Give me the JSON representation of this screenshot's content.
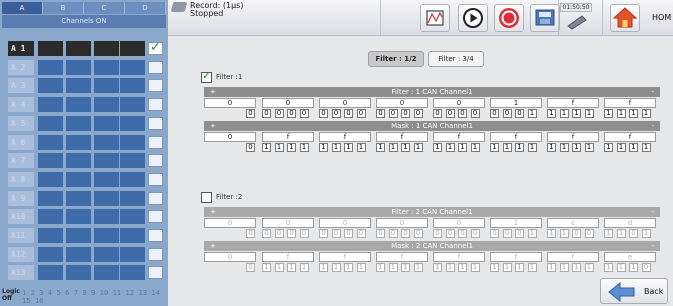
{
  "sidebar": {
    "group_tabs": [
      "A",
      "B",
      "C",
      "D"
    ],
    "channels_label": "Channels ON",
    "channels": [
      {
        "label": "A 1",
        "checked": true
      },
      {
        "label": "A 2",
        "checked": false
      },
      {
        "label": "A 3",
        "checked": false
      },
      {
        "label": "A 4",
        "checked": false
      },
      {
        "label": "A 5",
        "checked": false
      },
      {
        "label": "A 6",
        "checked": false
      },
      {
        "label": "A 7",
        "checked": false
      },
      {
        "label": "A 8",
        "checked": false
      },
      {
        "label": "A 9",
        "checked": false
      },
      {
        "label": "A10",
        "checked": false
      },
      {
        "label": "A11",
        "checked": false
      },
      {
        "label": "A12",
        "checked": false
      },
      {
        "label": "A13",
        "checked": false
      }
    ],
    "logic_label_top": "Logic",
    "logic_label_bottom": "Off",
    "logic_numbers": "1 2 3 4 5 6 7 8 9 10 11 12 13 14 15 16"
  },
  "toolbar": {
    "record_label": "Record: (1µs)",
    "status": "Stopped",
    "time": "01:50:50",
    "home_label": "HOM",
    "icons": [
      "waveform-icon",
      "play-icon",
      "record-icon",
      "save-icon",
      "probe-icon",
      "home-icon"
    ]
  },
  "main": {
    "tabs": [
      {
        "label": "Filter : 1/2",
        "active": true
      },
      {
        "label": "Filter : 3/4",
        "active": false
      }
    ],
    "filters": [
      {
        "label": "Filter :1",
        "checked": true,
        "filter_title": "Filter : 1 CAN Channel1",
        "filter_hex": [
          "0",
          "0",
          "0",
          "0",
          "0",
          "1",
          "f",
          "f"
        ],
        "filter_bits_first": "0",
        "filter_bits": [
          "0000",
          "0000",
          "0000",
          "0000",
          "0001",
          "1111",
          "1111"
        ],
        "mask_title": "Mask : 1 CAN Channel1",
        "mask_hex": [
          "0",
          "f",
          "f",
          "f",
          "f",
          "f",
          "f",
          "f"
        ],
        "mask_bits_first": "0",
        "mask_bits": [
          "1111",
          "1111",
          "1111",
          "1111",
          "1111",
          "1111",
          "1111"
        ]
      },
      {
        "label": "Filter :2",
        "checked": false,
        "filter_title": "Filter : 2 CAN Channel1",
        "filter_hex": [
          "0",
          "0",
          "0",
          "0",
          "0",
          "1",
          "c",
          "d"
        ],
        "filter_bits_first": "0",
        "filter_bits": [
          "0000",
          "0000",
          "0000",
          "0000",
          "0001",
          "1100",
          "1101"
        ],
        "mask_title": "Mask : 2 CAN Channel1",
        "mask_hex": [
          "0",
          "f",
          "f",
          "f",
          "f",
          "f",
          "f",
          "e"
        ],
        "mask_bits_first": "0",
        "mask_bits": [
          "1111",
          "1111",
          "1111",
          "1111",
          "1111",
          "1111",
          "1110"
        ]
      }
    ],
    "band_plus": "+",
    "band_minus": "-",
    "back_label": "Back"
  }
}
